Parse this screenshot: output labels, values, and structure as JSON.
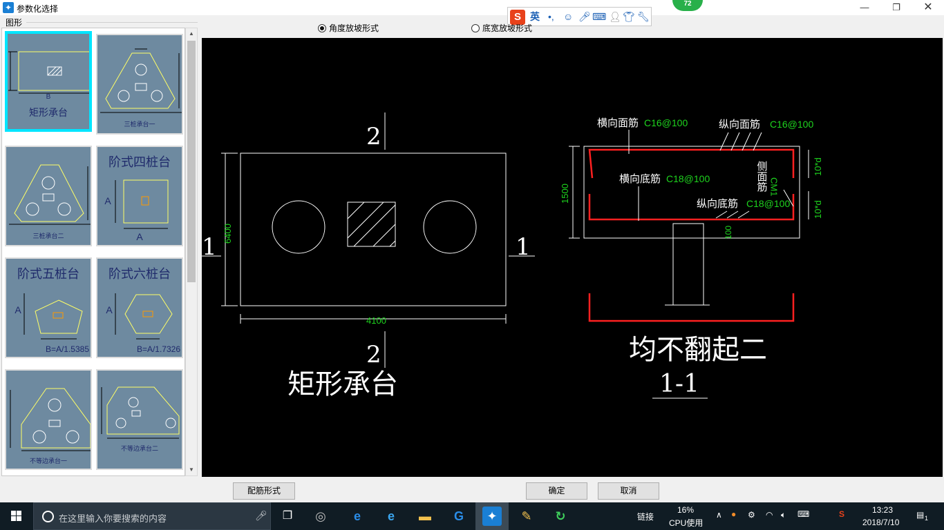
{
  "window": {
    "title": "参数化选择",
    "min_label": "—",
    "max_label": "❐",
    "close_label": "✕"
  },
  "ime": {
    "logo": "S",
    "lang": "英",
    "punct": "•,",
    "badge": "72"
  },
  "left_panel": {
    "group_label": "图形",
    "thumbnails": [
      {
        "name": "rect",
        "caption": "矩形承台",
        "sub": "B",
        "selected": true
      },
      {
        "name": "three-pile-1",
        "caption": "三桩承台一"
      },
      {
        "name": "three-pile-2",
        "caption": "三桩承台二"
      },
      {
        "name": "step-four",
        "title": "阶式四桩台",
        "sub": "A",
        "sub2": "A"
      },
      {
        "name": "step-five",
        "title": "阶式五桩台",
        "sub": "A",
        "formula": "B=A/1.5385"
      },
      {
        "name": "step-six",
        "title": "阶式六桩台",
        "sub": "A",
        "formula": "B=A/1.7326"
      },
      {
        "name": "unequal-1",
        "caption": "不等边承台一"
      },
      {
        "name": "unequal-2",
        "caption": "不等边承台二"
      }
    ]
  },
  "options": {
    "angle_slope": "角度放坡形式",
    "width_slope": "底宽放坡形式"
  },
  "drawing": {
    "section_top": "2",
    "section_bottom": "2",
    "section_left": "1",
    "section_right": "1",
    "dim_height": "6400",
    "dim_width": "4100",
    "plan_title": "矩形承台",
    "label_h_top": "横向面筋",
    "spec_h_top": "C16@100",
    "label_v_top": "纵向面筋",
    "spec_v_top": "C16@100",
    "label_h_bot": "横向底筋",
    "spec_h_bot": "C18@100",
    "label_v_bot": "纵向底筋",
    "spec_v_bot": "C18@100",
    "label_side": "侧面筋",
    "spec_side": "CM1",
    "dim_1500": "1500",
    "dim_10d_top": "10*d",
    "dim_10d_bot": "10*d",
    "dim_100": "100",
    "section_note": "均不翻起二",
    "section_name": "1-1"
  },
  "buttons": {
    "rebar_form": "配筋形式",
    "ok": "确定",
    "cancel": "取消"
  },
  "taskbar": {
    "search_placeholder": "在这里输入你要搜索的内容",
    "link_label": "链接",
    "cpu_value": "16%",
    "cpu_label": "CPU使用",
    "time": "13:23",
    "date": "2018/7/10",
    "notify_count": "1"
  },
  "colors": {
    "cad_bg": "#000000",
    "cad_white": "#ffffff",
    "cad_green": "#1ed41e",
    "cad_red": "#ff2020",
    "thumb_bg": "#6e8aa0",
    "thumb_selected": "#00e5ff"
  }
}
